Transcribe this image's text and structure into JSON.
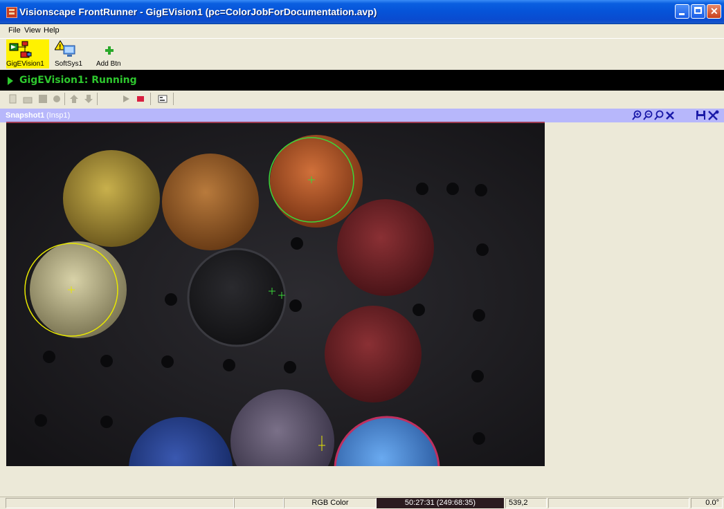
{
  "window": {
    "title": "Visionscape FrontRunner - GigEVision1 (pc=ColorJobForDocumentation.avp)"
  },
  "menu": {
    "items": [
      "File",
      "View",
      "Help"
    ]
  },
  "toolbar": {
    "buttons": [
      {
        "label": "GigEVision1",
        "icon": "device-network-icon",
        "active": true
      },
      {
        "label": "SoftSys1",
        "icon": "warning-computer-icon"
      },
      {
        "label": "Add Btn",
        "icon": "plus-icon"
      }
    ]
  },
  "run_status": {
    "text": "GigEVision1: Running",
    "color": "#2ec82e"
  },
  "snapshot": {
    "title": "Snapshot1",
    "subtitle": "(Insp1)"
  },
  "statusbar": {
    "color_mode": "RGB Color",
    "pixel_value": "50:27:31 (249:68:35)",
    "coords": "539,2",
    "angle": "0.0°"
  },
  "colors": {
    "accent": "#0a5fe0",
    "running": "#2ec82e",
    "snapshot_header": "#b7b7fb"
  }
}
